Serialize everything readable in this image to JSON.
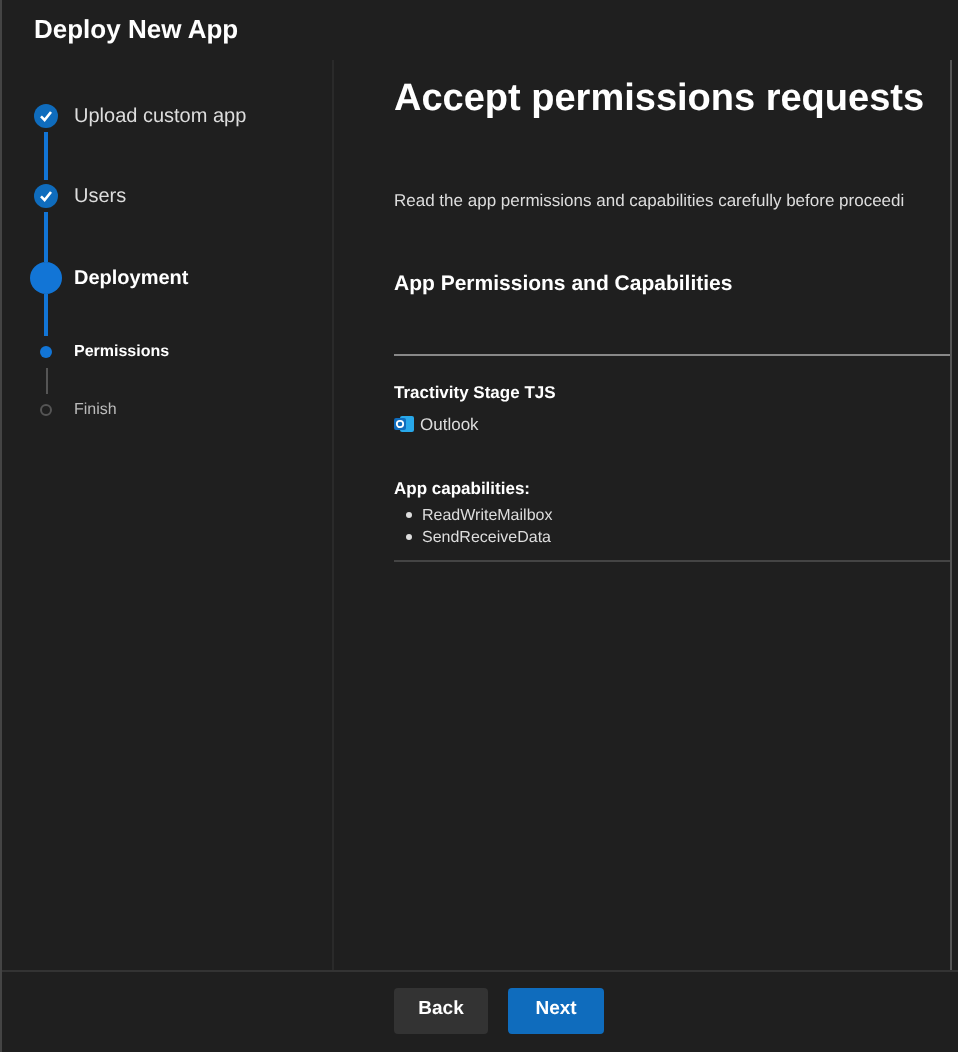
{
  "window": {
    "title": "Deploy New App"
  },
  "steps": [
    {
      "label": "Upload custom app",
      "kind": "step",
      "completed": true,
      "selected": false
    },
    {
      "label": "Users",
      "kind": "step",
      "completed": true,
      "selected": false
    },
    {
      "label": "Deployment",
      "kind": "step",
      "completed": false,
      "selected": true
    },
    {
      "label": "Permissions",
      "kind": "substep",
      "selected": true
    },
    {
      "label": "Finish",
      "kind": "substep",
      "selected": false
    }
  ],
  "content": {
    "heading": "Accept permissions requests",
    "intro": "Read the app permissions and capabilities carefully before proceedi",
    "section_title": "App Permissions and Capabilities",
    "app_name": "Tractivity Stage TJS",
    "host": "Outlook",
    "capabilities_title": "App capabilities:",
    "capabilities": [
      "ReadWriteMailbox",
      "SendReceiveData"
    ]
  },
  "buttons": [
    {
      "label": "Back",
      "kind": "secondary"
    },
    {
      "label": "Next",
      "kind": "primary"
    }
  ]
}
